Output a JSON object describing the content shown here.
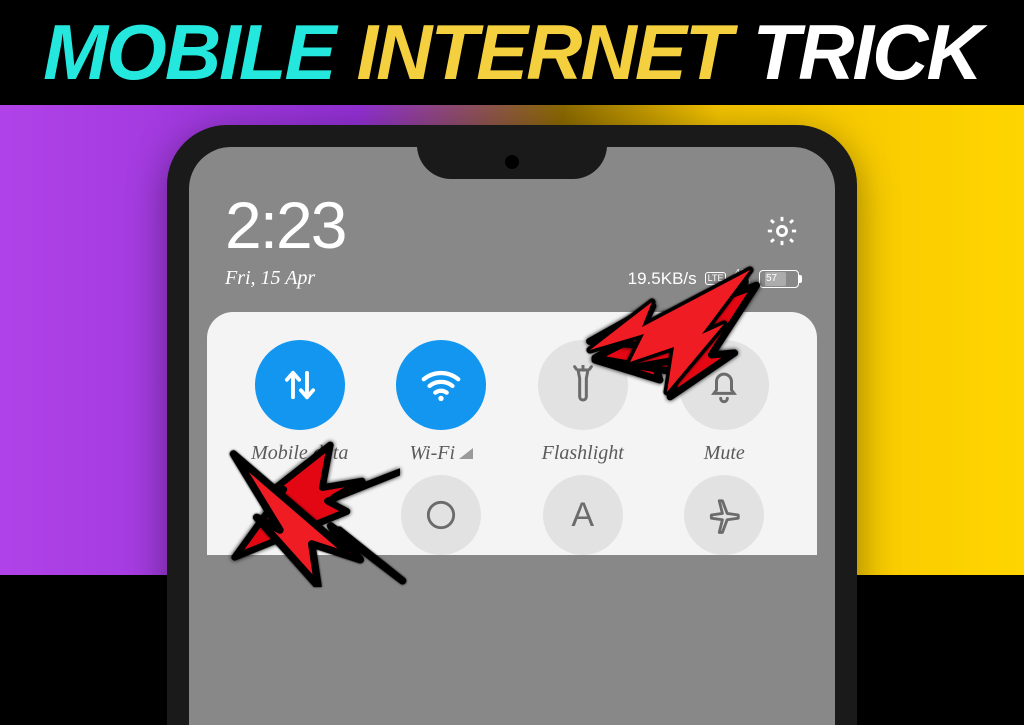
{
  "title": {
    "w1": "MOBILE",
    "w2": "INTERNET",
    "w3": "TRICK"
  },
  "status": {
    "time": "2:23",
    "date": "Fri, 15 Apr",
    "speed": "19.5KB/s",
    "sim": "LTE",
    "net": "4G",
    "battery": "57"
  },
  "qs": {
    "row1": [
      {
        "name": "mobile-data",
        "label": "Mobile data",
        "active": true,
        "icon": "updown"
      },
      {
        "name": "wifi",
        "label": "Wi-Fi",
        "active": true,
        "icon": "wifi",
        "signal": true
      },
      {
        "name": "flashlight",
        "label": "Flashlight",
        "active": false,
        "icon": "torch"
      },
      {
        "name": "mute",
        "label": "Mute",
        "active": false,
        "icon": "bell"
      }
    ],
    "row2": [
      {
        "name": "screenshot",
        "icon": "scissors"
      },
      {
        "name": "gps",
        "icon": "circle"
      },
      {
        "name": "auto",
        "icon": "letter-a"
      },
      {
        "name": "airplane",
        "icon": "plane"
      }
    ]
  }
}
